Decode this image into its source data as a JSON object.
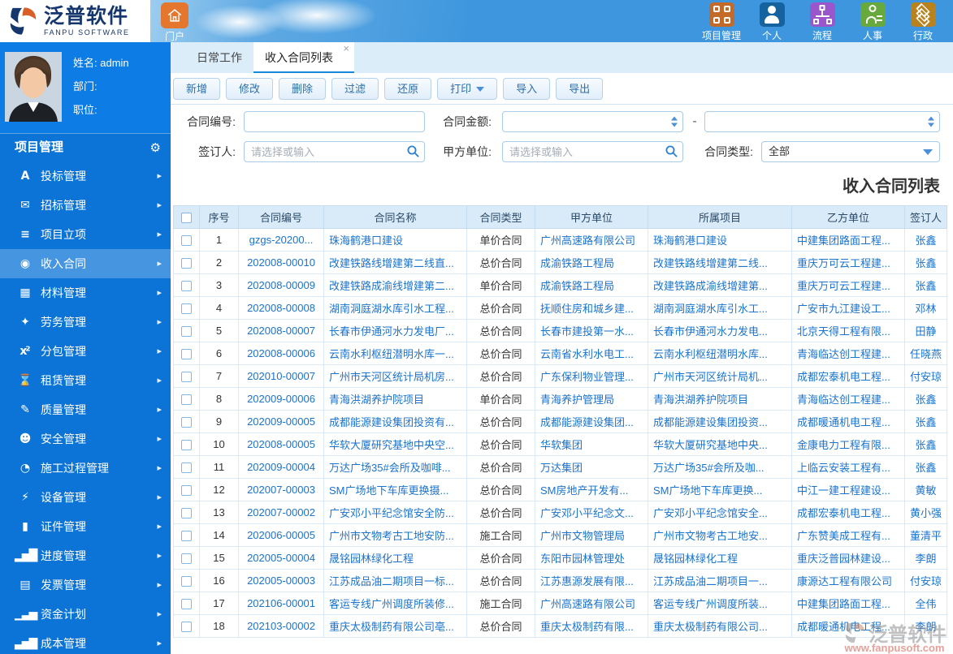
{
  "brand": {
    "logo_cn": "泛普软件",
    "logo_en": "FANPU SOFTWARE"
  },
  "header": {
    "portal": {
      "label": "门户",
      "icon": "home-icon",
      "color": "#e5762e"
    },
    "modules": [
      {
        "key": "project",
        "label": "项目管理",
        "icon": "grid-icon",
        "color": "#c46a28"
      },
      {
        "key": "personal",
        "label": "个人",
        "icon": "person-icon",
        "color": "#15639e"
      },
      {
        "key": "process",
        "label": "流程",
        "icon": "flow-icon",
        "color": "#9a57cc"
      },
      {
        "key": "hr",
        "label": "人事",
        "icon": "hr-person-icon",
        "color": "#68a93e"
      },
      {
        "key": "admin",
        "label": "行政",
        "icon": "layers-icon",
        "color": "#b9821d"
      }
    ]
  },
  "user_panel": {
    "name_label": "姓名:",
    "name_value": "admin",
    "dept_label": "部门:",
    "dept_value": "",
    "position_label": "职位:",
    "position_value": ""
  },
  "sidebar": {
    "section_title": "项目管理",
    "settings_icon": "gear-icon",
    "settings_glyph": "⚙",
    "chevron_glyph": "▸",
    "items": [
      {
        "key": "bid",
        "label": "投标管理",
        "icon": "bid-icon",
        "glyph": "A",
        "active": false
      },
      {
        "key": "tender",
        "label": "招标管理",
        "icon": "tender-icon",
        "glyph": "✉",
        "active": false
      },
      {
        "key": "project-setup",
        "label": "项目立项",
        "icon": "project-setup-icon",
        "glyph": "≡",
        "active": false
      },
      {
        "key": "income-contract",
        "label": "收入合同",
        "icon": "income-contract-icon",
        "glyph": "◉",
        "active": true
      },
      {
        "key": "material",
        "label": "材料管理",
        "icon": "material-icon",
        "glyph": "▦",
        "active": false
      },
      {
        "key": "labor",
        "label": "劳务管理",
        "icon": "labor-icon",
        "glyph": "✦",
        "active": false
      },
      {
        "key": "subcontract",
        "label": "分包管理",
        "icon": "subcontract-icon",
        "glyph": "x²",
        "active": false
      },
      {
        "key": "lease",
        "label": "租赁管理",
        "icon": "lease-icon",
        "glyph": "⌛",
        "active": false
      },
      {
        "key": "quality",
        "label": "质量管理",
        "icon": "quality-icon",
        "glyph": "✎",
        "active": false
      },
      {
        "key": "safety",
        "label": "安全管理",
        "icon": "safety-icon",
        "glyph": "☻",
        "active": false
      },
      {
        "key": "construction",
        "label": "施工过程管理",
        "icon": "construction-icon",
        "glyph": "◔",
        "active": false
      },
      {
        "key": "equipment",
        "label": "设备管理",
        "icon": "equipment-icon",
        "glyph": "⚡",
        "active": false
      },
      {
        "key": "certificate",
        "label": "证件管理",
        "icon": "certificate-icon",
        "glyph": "▮",
        "active": false
      },
      {
        "key": "progress",
        "label": "进度管理",
        "icon": "progress-icon",
        "glyph": "▂▅█",
        "active": false
      },
      {
        "key": "invoice",
        "label": "发票管理",
        "icon": "invoice-icon",
        "glyph": "▤",
        "active": false
      },
      {
        "key": "fund-plan",
        "label": "资金计划",
        "icon": "fund-plan-icon",
        "glyph": "▁▃▅",
        "active": false
      },
      {
        "key": "cost",
        "label": "成本管理",
        "icon": "cost-icon",
        "glyph": "▃▅▇",
        "active": false
      }
    ]
  },
  "tabs": [
    {
      "key": "daily-work",
      "label": "日常工作",
      "active": false,
      "closable": false
    },
    {
      "key": "income-contract-list",
      "label": "收入合同列表",
      "active": true,
      "closable": true,
      "close_glyph": "×"
    }
  ],
  "toolbar": {
    "buttons": [
      {
        "key": "add",
        "label": "新增",
        "dropdown": false
      },
      {
        "key": "edit",
        "label": "修改",
        "dropdown": false
      },
      {
        "key": "delete",
        "label": "删除",
        "dropdown": false
      },
      {
        "key": "filter",
        "label": "过滤",
        "dropdown": false
      },
      {
        "key": "restore",
        "label": "还原",
        "dropdown": false
      },
      {
        "key": "print",
        "label": "打印",
        "dropdown": true
      },
      {
        "key": "import",
        "label": "导入",
        "dropdown": false
      },
      {
        "key": "export",
        "label": "导出",
        "dropdown": false
      }
    ]
  },
  "filters": {
    "contract_no_label": "合同编号:",
    "contract_no_value": "",
    "contract_amount_label": "合同金额:",
    "amount_from_value": "",
    "amount_separator": "-",
    "amount_to_value": "",
    "signer_label": "签订人:",
    "signer_placeholder": "请选择或输入",
    "signer_value": "",
    "party_a_label": "甲方单位:",
    "party_a_placeholder": "请选择或输入",
    "party_a_value": "",
    "contract_type_label": "合同类型:",
    "contract_type_value": "全部"
  },
  "list": {
    "title": "收入合同列表",
    "columns": [
      "序号",
      "合同编号",
      "合同名称",
      "合同类型",
      "甲方单位",
      "所属项目",
      "乙方单位",
      "签订人"
    ],
    "rows": [
      {
        "seq": "1",
        "code": "gzgs-20200...",
        "name": "珠海鹤港口建设",
        "type": "单价合同",
        "party_a": "广州高速路有限公司",
        "project": "珠海鹤港口建设",
        "party_b": "中建集团路面工程...",
        "signer": "张鑫"
      },
      {
        "seq": "2",
        "code": "202008-00010",
        "name": "改建铁路线增建第二线直...",
        "type": "总价合同",
        "party_a": "成渝铁路工程局",
        "project": "改建铁路线增建第二线...",
        "party_b": "重庆万可云工程建...",
        "signer": "张鑫"
      },
      {
        "seq": "3",
        "code": "202008-00009",
        "name": "改建铁路成渝线增建第二...",
        "type": "单价合同",
        "party_a": "成渝铁路工程局",
        "project": "改建铁路成渝线增建第...",
        "party_b": "重庆万可云工程建...",
        "signer": "张鑫"
      },
      {
        "seq": "4",
        "code": "202008-00008",
        "name": "湖南洞庭湖水库引水工程...",
        "type": "总价合同",
        "party_a": "抚顺住房和城乡建...",
        "project": "湖南洞庭湖水库引水工...",
        "party_b": "广安市九江建设工...",
        "signer": "邓林"
      },
      {
        "seq": "5",
        "code": "202008-00007",
        "name": "长春市伊通河水力发电厂...",
        "type": "总价合同",
        "party_a": "长春市建投第一水...",
        "project": "长春市伊通河水力发电...",
        "party_b": "北京天得工程有限...",
        "signer": "田静"
      },
      {
        "seq": "6",
        "code": "202008-00006",
        "name": "云南水利枢纽潜明水库一...",
        "type": "总价合同",
        "party_a": "云南省水利水电工...",
        "project": "云南水利枢纽潜明水库...",
        "party_b": "青海临达创工程建...",
        "signer": "任晓燕"
      },
      {
        "seq": "7",
        "code": "202010-00007",
        "name": "广州市天河区统计局机房...",
        "type": "总价合同",
        "party_a": "广东保利物业管理...",
        "project": "广州市天河区统计局机...",
        "party_b": "成都宏泰机电工程...",
        "signer": "付安琼"
      },
      {
        "seq": "8",
        "code": "202009-00006",
        "name": "青海洪湖养护院项目",
        "type": "单价合同",
        "party_a": "青海养护管理局",
        "project": "青海洪湖养护院项目",
        "party_b": "青海临达创工程建...",
        "signer": "张鑫"
      },
      {
        "seq": "9",
        "code": "202009-00005",
        "name": "成都能源建设集团投资有...",
        "type": "总价合同",
        "party_a": "成都能源建设集团...",
        "project": "成都能源建设集团投资...",
        "party_b": "成都暖通机电工程...",
        "signer": "张鑫"
      },
      {
        "seq": "10",
        "code": "202008-00005",
        "name": "华软大厦研究基地中央空...",
        "type": "总价合同",
        "party_a": "华软集团",
        "project": "华软大厦研究基地中央...",
        "party_b": "金康电力工程有限...",
        "signer": "张鑫"
      },
      {
        "seq": "11",
        "code": "202009-00004",
        "name": "万达广场35#会所及咖啡...",
        "type": "总价合同",
        "party_a": "万达集团",
        "project": "万达广场35#会所及咖...",
        "party_b": "上临云安装工程有...",
        "signer": "张鑫"
      },
      {
        "seq": "12",
        "code": "202007-00003",
        "name": "SM广场地下车库更换摄...",
        "type": "总价合同",
        "party_a": "SM房地产开发有...",
        "project": "SM广场地下车库更换...",
        "party_b": "中江一建工程建设...",
        "signer": "黄敏"
      },
      {
        "seq": "13",
        "code": "202007-00002",
        "name": "广安邓小平纪念馆安全防...",
        "type": "总价合同",
        "party_a": "广安邓小平纪念文...",
        "project": "广安邓小平纪念馆安全...",
        "party_b": "成都宏泰机电工程...",
        "signer": "黄小强"
      },
      {
        "seq": "14",
        "code": "202006-00005",
        "name": "广州市文物考古工地安防...",
        "type": "施工合同",
        "party_a": "广州市文物管理局",
        "project": "广州市文物考古工地安...",
        "party_b": "广东赞美成工程有...",
        "signer": "董清平"
      },
      {
        "seq": "15",
        "code": "202005-00004",
        "name": "晟铭园林绿化工程",
        "type": "总价合同",
        "party_a": "东阳市园林管理处",
        "project": "晟铭园林绿化工程",
        "party_b": "重庆泛普园林建设...",
        "signer": "李朗"
      },
      {
        "seq": "16",
        "code": "202005-00003",
        "name": "江苏成品油二期项目一标...",
        "type": "总价合同",
        "party_a": "江苏惠源发展有限...",
        "project": "江苏成品油二期项目一...",
        "party_b": "康源达工程有限公司",
        "signer": "付安琼"
      },
      {
        "seq": "17",
        "code": "202106-00001",
        "name": "客运专线广州调度所装修...",
        "type": "施工合同",
        "party_a": "广州高速路有限公司",
        "project": "客运专线广州调度所装...",
        "party_b": "中建集团路面工程...",
        "signer": "全伟"
      },
      {
        "seq": "18",
        "code": "202103-00002",
        "name": "重庆太极制药有限公司亳...",
        "type": "总价合同",
        "party_a": "重庆太极制药有限...",
        "project": "重庆太极制药有限公司...",
        "party_b": "成都暖通机电工程...",
        "signer": "李朗"
      }
    ]
  },
  "watermark": {
    "brand": "泛普软件",
    "site": "www.fanpusoft.com"
  },
  "colors": {
    "sidebar": "#0c74d6",
    "header_blue": "#3e97de",
    "link": "#1a73cd",
    "table_header_bg": "#d9eaf8",
    "accent": "#1688d8"
  }
}
